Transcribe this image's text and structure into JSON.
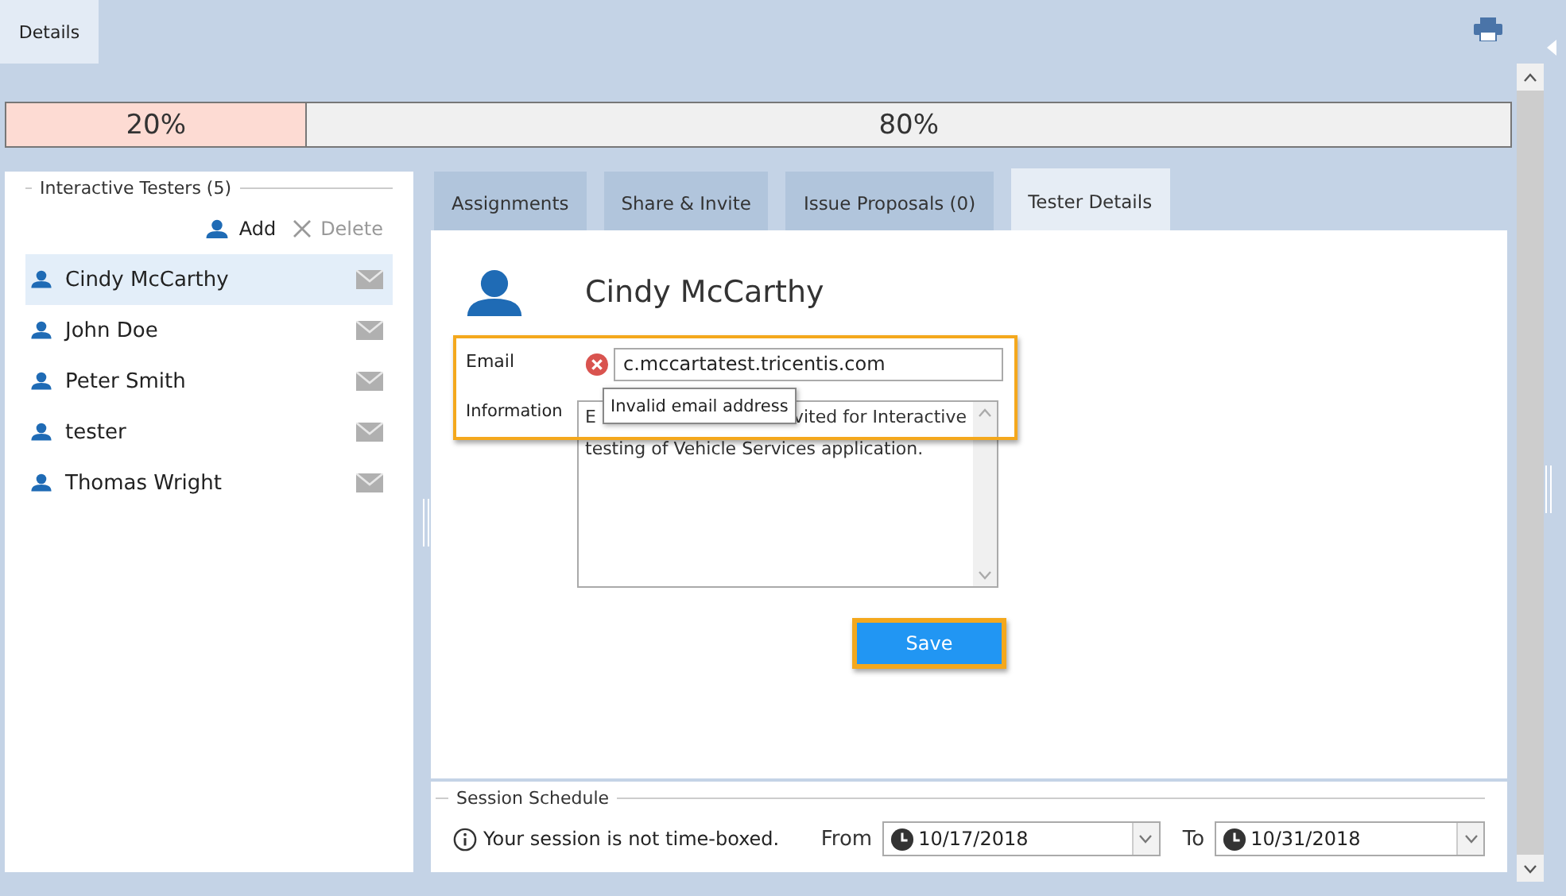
{
  "top_tab": {
    "label": "Details",
    "selected": true
  },
  "progress": [
    {
      "label": "20%",
      "level": 0.2,
      "color": "#fddbd3"
    },
    {
      "label": "80%",
      "level": 0.8,
      "color": "#f0f0f0"
    }
  ],
  "testers_panel": {
    "title": "Interactive Testers (5)",
    "add": "Add",
    "delete": "Delete",
    "testers": [
      {
        "name": "Cindy McCarthy",
        "selected": true
      },
      {
        "name": "John Doe",
        "selected": false
      },
      {
        "name": "Peter Smith",
        "selected": false
      },
      {
        "name": "tester",
        "selected": false
      },
      {
        "name": "Thomas Wright",
        "selected": false
      }
    ]
  },
  "tabs": [
    {
      "label": "Assignments",
      "selected": false
    },
    {
      "label": "Share & Invite",
      "selected": false
    },
    {
      "label": "Issue Proposals (0)",
      "selected": false
    },
    {
      "label": "Tester Details",
      "selected": true
    }
  ],
  "details": {
    "name": "Cindy McCarthy",
    "email_label": "Email",
    "email_value": "c.mccartatest.tricentis.com",
    "email_error": "Invalid email address",
    "information_label": "Information",
    "information_visible": [
      "E",
      "vited for Interactive",
      "testing of Vehicle Services application."
    ],
    "save": "Save"
  },
  "schedule": {
    "title": "Session Schedule",
    "note": "Your session is not time-boxed.",
    "from_label": "From",
    "from_value": "10/17/2018",
    "to_label": "To",
    "to_value": "10/31/2018"
  }
}
